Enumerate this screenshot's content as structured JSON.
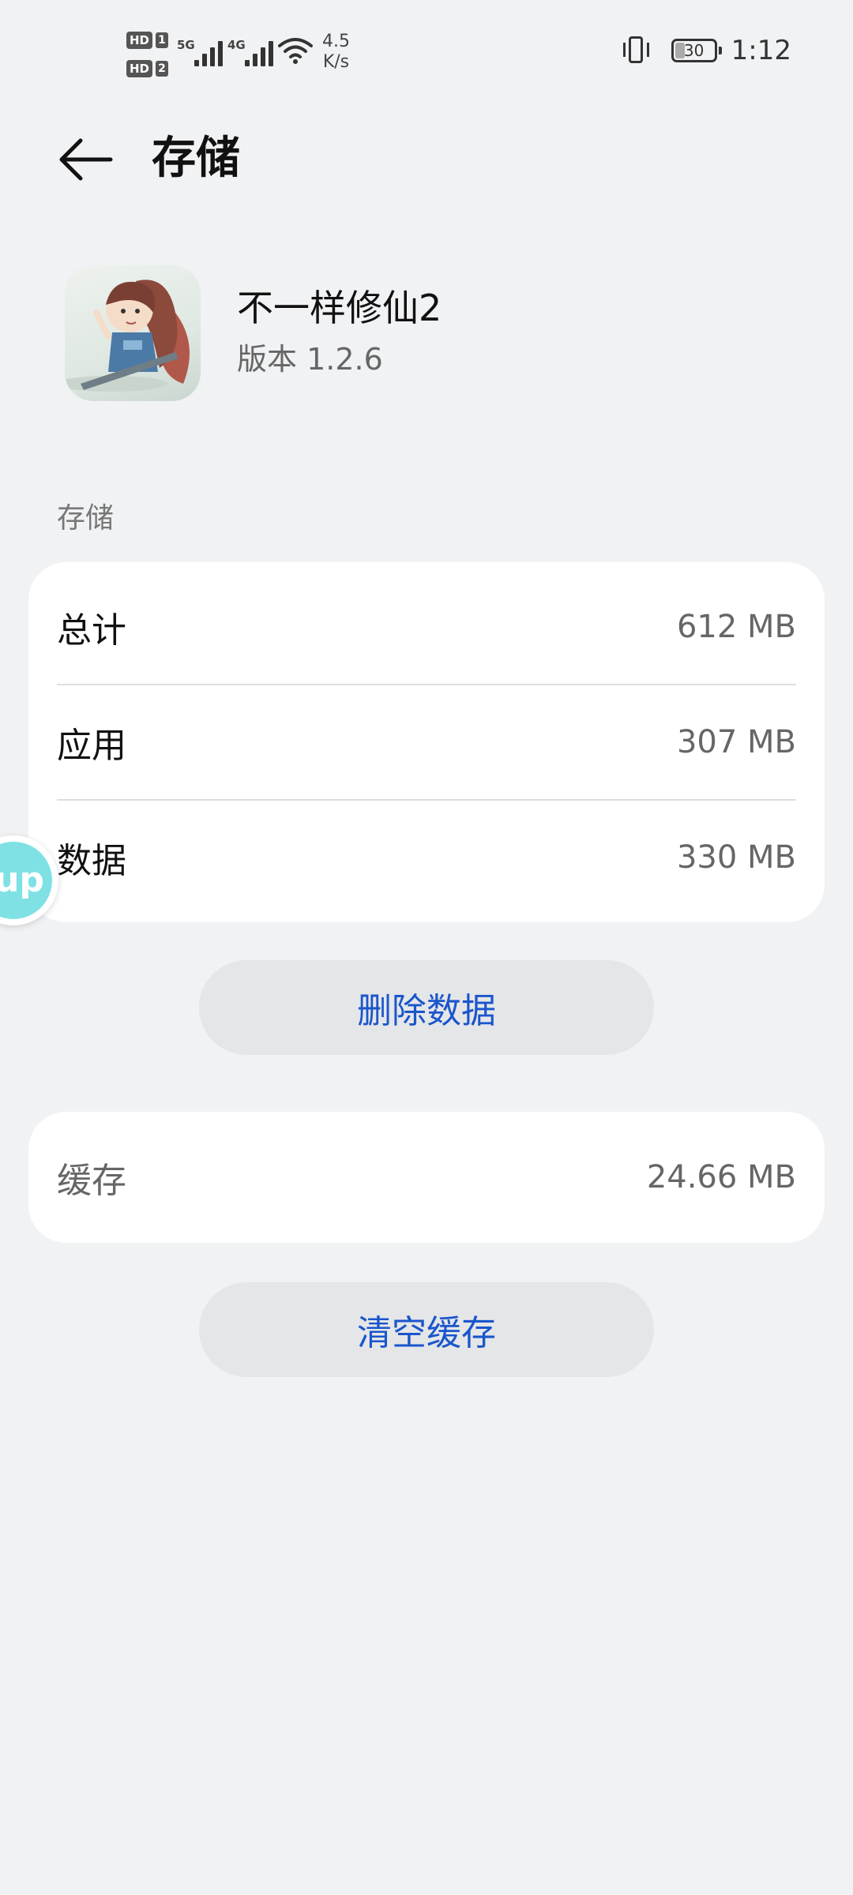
{
  "status_bar": {
    "hd1": "HD",
    "sim1": "1",
    "hd2": "HD",
    "sim2": "2",
    "net1": "5G",
    "net2": "4G",
    "speed_value": "4.5",
    "speed_unit": "K/s",
    "battery": "30",
    "time": "1:12"
  },
  "header": {
    "title": "存储"
  },
  "app": {
    "name": "不一样修仙2",
    "version": "版本 1.2.6"
  },
  "storage_section": {
    "label": "存储",
    "rows": [
      {
        "label": "总计",
        "value": "612 MB"
      },
      {
        "label": "应用",
        "value": "307 MB"
      },
      {
        "label": "数据",
        "value": "330 MB"
      }
    ]
  },
  "delete_button": "删除数据",
  "cache": {
    "label": "缓存",
    "value": "24.66 MB"
  },
  "clear_button": "清空缓存",
  "float_bubble_text": "up"
}
